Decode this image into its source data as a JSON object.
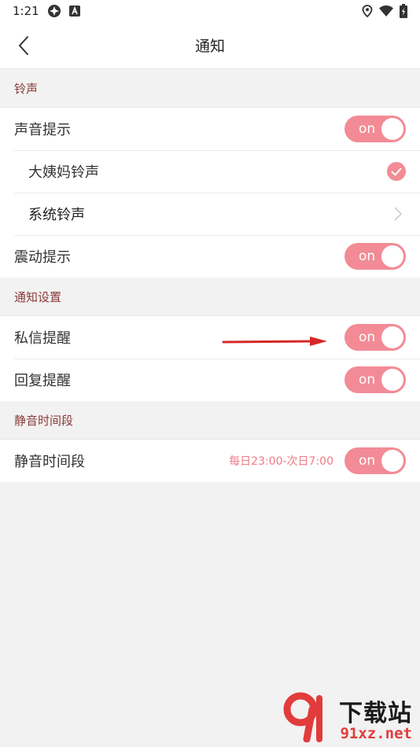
{
  "status_bar": {
    "time": "1:21"
  },
  "nav": {
    "title": "通知"
  },
  "sections": {
    "ringtone": {
      "header": "铃声",
      "sound_alert_label": "声音提示",
      "sound_alert_toggle": "on",
      "dayima_label": "大姨妈铃声",
      "system_label": "系统铃声",
      "vibrate_label": "震动提示",
      "vibrate_toggle": "on"
    },
    "notify": {
      "header": "通知设置",
      "pm_label": "私信提醒",
      "pm_toggle": "on",
      "reply_label": "回复提醒",
      "reply_toggle": "on"
    },
    "quiet": {
      "header": "静音时间段",
      "label": "静音时间段",
      "schedule": "每日23:00-次日7:00",
      "toggle": "on"
    }
  },
  "watermark": {
    "logo_text": "下载站",
    "domain": "91xz.net"
  },
  "colors": {
    "accent": "#f28b95",
    "section_header_text": "#8b3a3a",
    "schedule_text": "#f07a86",
    "annotation_arrow": "#d62828"
  }
}
